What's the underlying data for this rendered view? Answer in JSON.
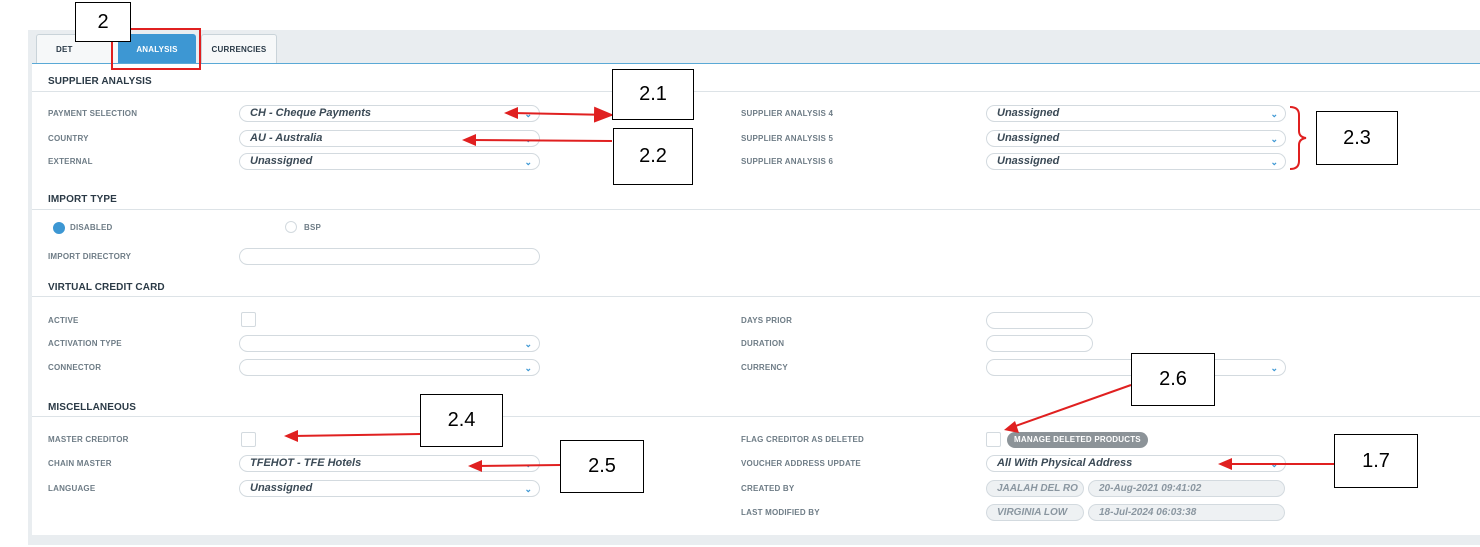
{
  "tabs": [
    {
      "label": "DET",
      "active": false
    },
    {
      "label": "ANALYSIS",
      "active": true
    },
    {
      "label": "CURRENCIES",
      "active": false
    }
  ],
  "supplier_analysis": {
    "heading": "SUPPLIER ANALYSIS",
    "payment_selection": {
      "label": "PAYMENT SELECTION",
      "value": "CH - Cheque Payments"
    },
    "country": {
      "label": "COUNTRY",
      "value": "AU - Australia"
    },
    "external": {
      "label": "EXTERNAL",
      "value": "Unassigned"
    },
    "analysis4": {
      "label": "SUPPLIER ANALYSIS 4",
      "value": "Unassigned"
    },
    "analysis5": {
      "label": "SUPPLIER ANALYSIS 5",
      "value": "Unassigned"
    },
    "analysis6": {
      "label": "SUPPLIER ANALYSIS 6",
      "value": "Unassigned"
    }
  },
  "import_type": {
    "heading": "IMPORT TYPE",
    "option_disabled": "DISABLED",
    "option_bsp": "BSP",
    "selected": "DISABLED",
    "directory_label": "IMPORT DIRECTORY",
    "directory_value": ""
  },
  "vcc": {
    "heading": "VIRTUAL CREDIT CARD",
    "active_label": "ACTIVE",
    "activation_type_label": "ACTIVATION TYPE",
    "connector_label": "CONNECTOR",
    "days_prior_label": "DAYS PRIOR",
    "duration_label": "DURATION",
    "currency_label": "CURRENCY"
  },
  "misc": {
    "heading": "MISCELLANEOUS",
    "master_creditor_label": "MASTER CREDITOR",
    "chain_master": {
      "label": "CHAIN MASTER",
      "value": "TFEHOT - TFE Hotels"
    },
    "language": {
      "label": "LANGUAGE",
      "value": "Unassigned"
    },
    "flag_deleted_label": "FLAG CREDITOR AS DELETED",
    "manage_deleted_button": "MANAGE DELETED PRODUCTS",
    "voucher_address": {
      "label": "VOUCHER ADDRESS UPDATE",
      "value": "All With Physical Address"
    },
    "created_by": {
      "label": "CREATED BY",
      "user": "JAALAH DEL RO",
      "date": "20-Aug-2021 09:41:02"
    },
    "last_modified_by": {
      "label": "LAST MODIFIED BY",
      "user": "VIRGINIA LOW",
      "date": "18-Jul-2024 06:03:38"
    }
  },
  "callouts": {
    "c2": "2",
    "c21": "2.1",
    "c22": "2.2",
    "c23": "2.3",
    "c24": "2.4",
    "c25": "2.5",
    "c26": "2.6",
    "c17": "1.7"
  },
  "colors": {
    "accent": "#3d97d3",
    "annotation": "#e02020"
  },
  "icons": {
    "select": "chevron-down-icon"
  }
}
